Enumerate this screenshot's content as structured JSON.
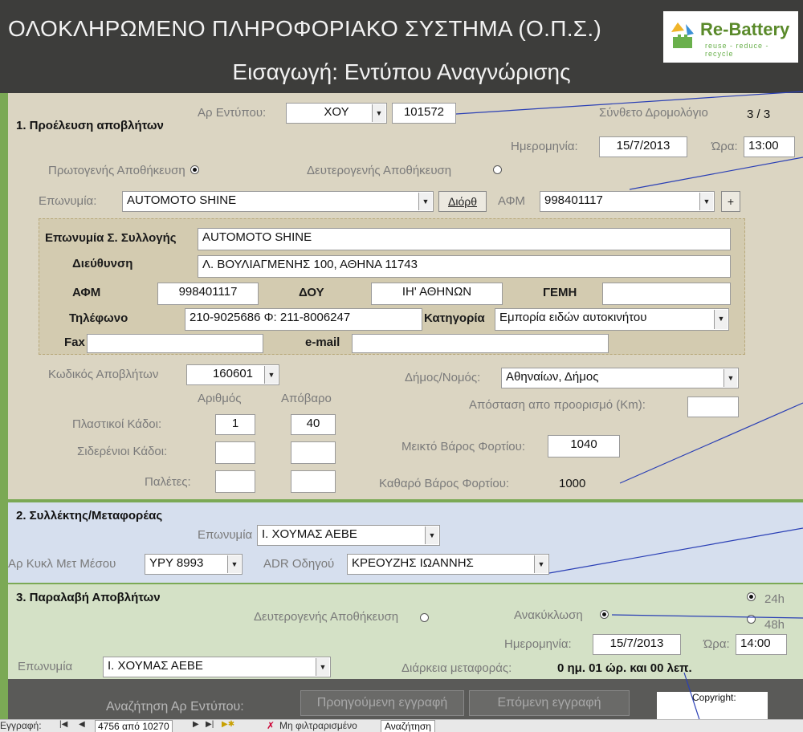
{
  "header": {
    "title": "ΟΛΟΚΛΗΡΩΜΕΝΟ ΠΛΗΡΟΦΟΡΙΑΚΟ ΣΥΣΤΗΜΑ (Ο.Π.Σ.)",
    "subtitle": "Εισαγωγή: Εντύπου Αναγνώρισης",
    "logo_text": "Re-Battery",
    "logo_tagline": "reuse - reduce - recycle"
  },
  "section1": {
    "heading": "1. Προέλευση αποβλήτων",
    "ar_entypou_label": "Αρ Εντύπου:",
    "ar_entypou_series": "ΧΟΥ",
    "ar_entypou_number": "101572",
    "route_label": "Σύνθετο Δρομολόγιο",
    "route_value": "3 / 3",
    "date_label": "Ημερομηνία:",
    "date_value": "15/7/2013",
    "time_label": "Ώρα:",
    "time_value": "13:00",
    "primary_storage_label": "Πρωτογενής Αποθήκευση",
    "secondary_storage_label": "Δευτερογενής Αποθήκευση",
    "company_label": "Επωνυμία:",
    "company_value": "AUTOMOTO SHINE",
    "edit_button": "Διόρθ",
    "afm_label": "ΑΦΜ",
    "afm_value": "998401117",
    "add_button": "+",
    "collection": {
      "name_label": "Επωνυμία Σ. Συλλογής",
      "name_value": "AUTOMOTO SHINE",
      "address_label": "Διεύθυνση",
      "address_value": "Λ. ΒΟΥΛΙΑΓΜΕΝΗΣ 100, ΑΘΗΝΑ 11743",
      "afm_label": "ΑΦΜ",
      "afm_value": "998401117",
      "doy_label": "ΔΟΥ",
      "doy_value": "ΙΗ' ΑΘΗΝΩΝ",
      "gemh_label": "ΓΕΜΗ",
      "gemh_value": "",
      "phone_label": "Τηλέφωνο",
      "phone_value": "210-9025686 Φ: 211-8006247",
      "category_label": "Κατηγορία",
      "category_value": "Εμπορία ειδών αυτοκινήτου",
      "fax_label": "Fax",
      "fax_value": "",
      "email_label": "e-mail",
      "email_value": ""
    },
    "waste_code_label": "Κωδικός Αποβλήτων",
    "waste_code_value": "160601",
    "municipality_label": "Δήμος/Νομός:",
    "municipality_value": "Αθηναίων, Δήμος",
    "count_header": "Αριθμός",
    "tare_header": "Απόβαρο",
    "distance_label": "Απόσταση απο προορισμό (Km):",
    "distance_value": "",
    "plastic_bins_label": "Πλαστικοί Κάδοι:",
    "plastic_bins_count": "1",
    "plastic_bins_tare": "40",
    "iron_bins_label": "Σιδερένιοι Κάδοι:",
    "pallets_label": "Παλέτες:",
    "gross_weight_label": "Μεικτό Βάρος Φορτίου:",
    "gross_weight_value": "1040",
    "net_weight_label": "Καθαρό Βάρος Φορτίου:",
    "net_weight_value": "1000"
  },
  "section2": {
    "heading": "2. Συλλέκτης/Μεταφορέας",
    "company_label": "Επωνυμία",
    "company_value": "Ι. ΧΟΥΜΑΣ ΑΕΒΕ",
    "vehicle_label": "Αρ Κυκλ Μετ Μέσου",
    "vehicle_value": "ΥΡΥ 8993",
    "driver_label": "ADR Οδηγού",
    "driver_value": "ΚΡΕΟΥΖΗΣ ΙΩΑΝΝΗΣ"
  },
  "section3": {
    "heading": "3. Παραλαβή Αποβλήτων",
    "secondary_storage_label": "Δευτερογενής Αποθήκευση",
    "recycling_label": "Ανακύκλωση",
    "opt_24h": "24h",
    "opt_48h": "48h",
    "date_label": "Ημερομηνία:",
    "date_value": "15/7/2013",
    "time_label": "Ώρα:",
    "time_value": "14:00",
    "company_label": "Επωνυμία",
    "company_value": "Ι. ΧΟΥΜΑΣ ΑΕΒΕ",
    "duration_label": "Διάρκεια μεταφοράς:",
    "duration_value": "0 ημ. 01 ώρ. και 00 λεπ."
  },
  "footer": {
    "search_label": "Αναζήτηση Αρ Εντύπου:",
    "prev_button": "Προηγούμενη εγγραφή",
    "next_button": "Επόμενη εγγραφή",
    "copyright_label": "Copyright:"
  },
  "statusbar": {
    "record_label": "Εγγραφή:",
    "record_position": "4756 από 10270",
    "filter_label": "Μη φιλτραρισμένο",
    "search_label": "Αναζήτηση"
  }
}
